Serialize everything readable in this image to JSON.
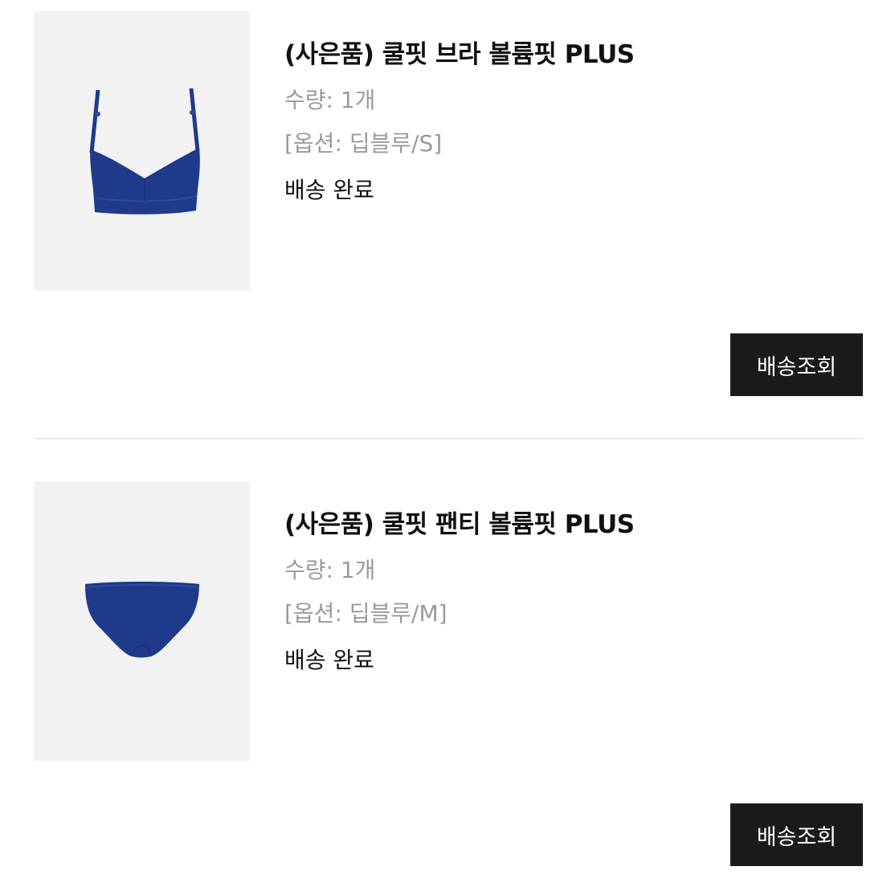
{
  "orders": [
    {
      "product_name": "(사은품) 쿨핏 브라 볼륨핏 PLUS",
      "quantity": "수량: 1개",
      "option": "[옵션: 딥블루/S]",
      "status": "배송 완료",
      "button_label": "배송조회",
      "image_icon": "bra-product-image",
      "product_color": "#1f3a8a"
    },
    {
      "product_name": "(사은품) 쿨핏 팬티 볼륨핏 PLUS",
      "quantity": "수량: 1개",
      "option": "[옵션: 딥블루/M]",
      "status": "배송 완료",
      "button_label": "배송조회",
      "image_icon": "panty-product-image",
      "product_color": "#1f3a8a"
    }
  ],
  "colors": {
    "button_bg": "#1b1b1b",
    "thumb_bg": "#f2f2f2",
    "muted_text": "#9a9a9a",
    "divider": "#ebebeb"
  }
}
